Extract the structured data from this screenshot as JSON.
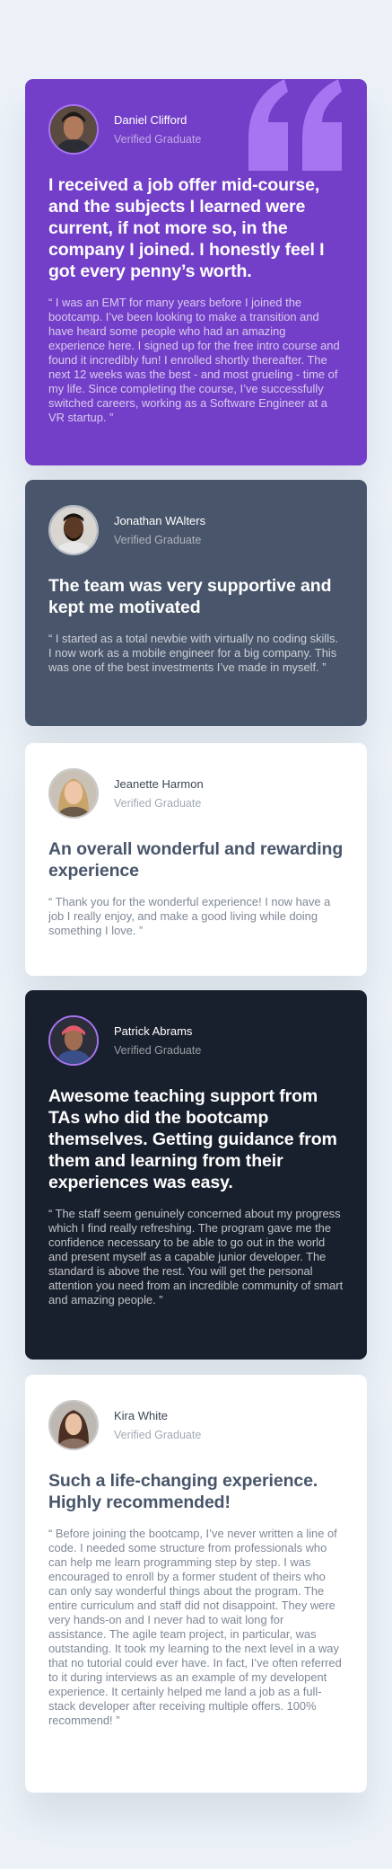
{
  "colors": {
    "page_bg": "#ecf2f8",
    "moderate_violet": "#733fc8",
    "grayish_blue": "#48556a",
    "white": "#ffffff",
    "very_dark_blackish_blue": "#19202d",
    "light_violet_accent": "#a775f1"
  },
  "testimonials": [
    {
      "name": "Daniel Clifford",
      "role": "Verified Graduate",
      "title": "I received a job offer mid-course, and the subjects I learned were current, if not more so, in the company I joined. I honestly feel I got every penny’s worth.",
      "body": "“ I was an EMT for many years before I joined the bootcamp. I’ve been looking to make a transition and have heard some people who had an amazing experience here. I signed up for the free intro course and found it incredibly fun! I enrolled shortly thereafter. The next 12 weeks was the best - and most grueling - time of my life. Since completing the course, I’ve successfully switched careers, working as a Software Engineer at a VR startup. ”",
      "icon": "quotation-mark-icon"
    },
    {
      "name": "Jonathan WAlters",
      "role": "Verified Graduate",
      "title": "The team was very supportive and kept me motivated",
      "body": "“ I started as a total newbie with virtually no coding skills. I now work as a mobile engineer for a big company. This was one of the best investments I’ve made in myself. ”"
    },
    {
      "name": "Jeanette Harmon",
      "role": "Verified Graduate",
      "title": "An overall wonderful and rewarding experience",
      "body": "“ Thank you for the wonderful experience! I now have a job I really enjoy, and make a good living while doing something I love. ”"
    },
    {
      "name": "Patrick Abrams",
      "role": "Verified Graduate",
      "title": "Awesome teaching support from TAs who did the bootcamp themselves. Getting guidance from them and learning from their experiences was easy.",
      "body": "“ The staff seem genuinely concerned about my progress which I find really refreshing. The program gave me the confidence necessary to be able to go out in the world and present myself as a capable junior developer. The standard is above the rest. You will get the personal attention you need from an incredible community of smart and amazing people. ”"
    },
    {
      "name": "Kira White",
      "role": "Verified Graduate",
      "title": "Such a life-changing experience. Highly recommended!",
      "body": "“ Before joining the bootcamp, I’ve never written a line of code. I needed some structure from professionals who can help me learn programming step by step. I was encouraged to enroll by a former student of theirs who can only say wonderful things about the program. The entire curriculum and staff did not disappoint. They were very hands-on and I never had to wait long for assistance. The agile team project, in particular, was outstanding. It took my learning to the next level in a way that no tutorial could ever have. In fact, I’ve often referred to it during interviews as an example of my developent experience. It certainly helped me land a job as a full-stack developer after receiving multiple offers. 100% recommend! ”"
    }
  ]
}
